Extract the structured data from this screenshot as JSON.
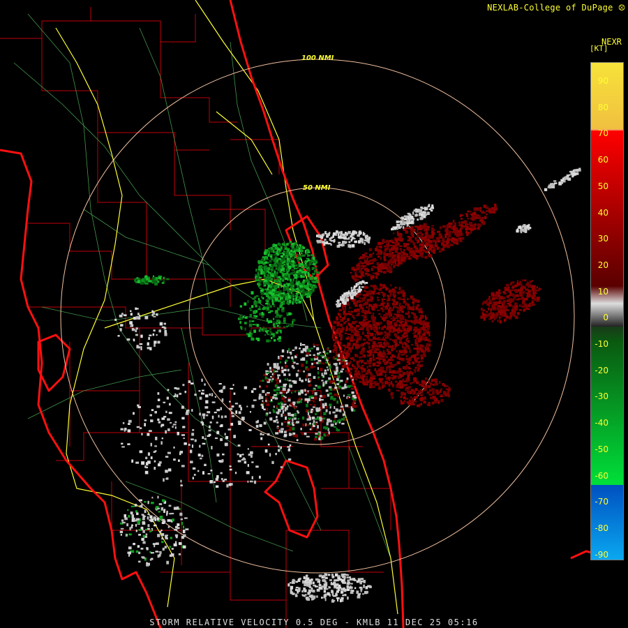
{
  "header": {
    "credit": "NEXLAB-College of DuPage",
    "credit_icon": "cod-logo-icon"
  },
  "legend": {
    "title": "NEXR",
    "unit": "[KT]",
    "ticks": [
      "90",
      "80",
      "70",
      "60",
      "50",
      "40",
      "30",
      "20",
      "10",
      "0",
      "-10",
      "-20",
      "-30",
      "-40",
      "-50",
      "-60",
      "-70",
      "-80",
      "-90"
    ],
    "colors": {
      "top": "#f7e23a",
      "orange": "#f59a5c",
      "red": "#ff0000",
      "darkred": "#7a0000",
      "gray": "#cccccc",
      "darkgreen": "#0a5a10",
      "green": "#00e03a",
      "blue": "#0050c0",
      "cyan": "#0aa8f0"
    }
  },
  "rings": {
    "outer_label": "100 NMI",
    "inner_label": "50 NMI"
  },
  "footer": {
    "product_line": "STORM RELATIVE VELOCITY 0.5 DEG - KMLB 11 DEC 25 05:16"
  }
}
